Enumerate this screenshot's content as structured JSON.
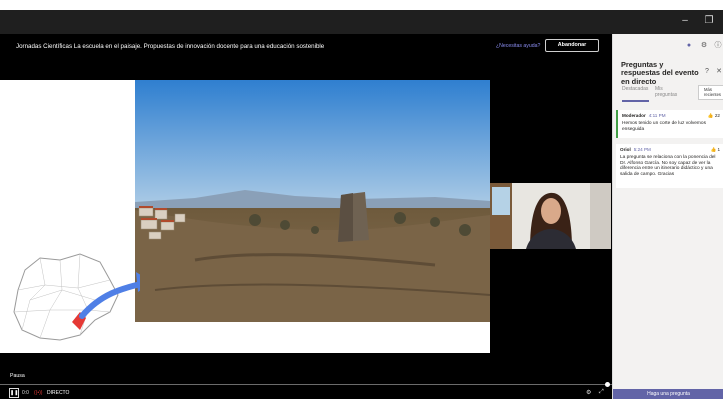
{
  "window": {
    "minimize": "–",
    "restore": "❐"
  },
  "event": {
    "title": "Jornadas Científicas La escuela en el paisaje. Propuestas de innovación docente para una educación sostenible",
    "help_link": "¿Necesitas ayuda?",
    "leave_button": "Abandonar"
  },
  "player": {
    "caption": "Pausa",
    "time": "0:0",
    "live_label": "DIRECTO",
    "progress": 0.99
  },
  "qa": {
    "title": "Preguntas y respuestas del evento en directo",
    "tabs": [
      "Destacadas",
      "Mis preguntas"
    ],
    "sort": "Más recientes",
    "questions": [
      {
        "author": "Moderador",
        "time": "4:11 PM",
        "likes": "22",
        "text": "Hemos tenido un corte de luz volvemos enseguida"
      },
      {
        "author": "Oriol",
        "time": "5:24 PM",
        "likes": "1",
        "text": "La pregunta se relaciona con la ponencia del Dr. Alfonso García. No soy capaz de ver la diferencia entre un itinerario didáctico y una salida de campo. Gracias"
      }
    ],
    "ask_button": "Haga una pregunta"
  },
  "colors": {
    "accent": "#6264a7",
    "live": "#e53935",
    "moderator_bar": "#43a047"
  }
}
